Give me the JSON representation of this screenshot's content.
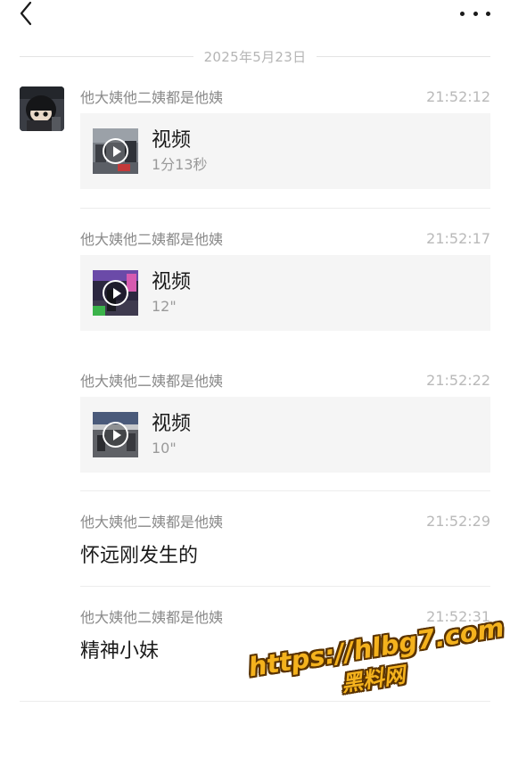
{
  "date_divider": "2025年5月23日",
  "icons": {
    "back": "chevron-left-icon",
    "more": "more-dots-icon",
    "play": "play-icon"
  },
  "messages": [
    {
      "sender": "他大姨他二姨都是他姨",
      "time": "21:52:12",
      "type": "video",
      "title": "视频",
      "duration": "1分13秒"
    },
    {
      "sender": "他大姨他二姨都是他姨",
      "time": "21:52:17",
      "type": "video",
      "title": "视频",
      "duration": "12\""
    },
    {
      "sender": "他大姨他二姨都是他姨",
      "time": "21:52:22",
      "type": "video",
      "title": "视频",
      "duration": "10\""
    },
    {
      "sender": "他大姨他二姨都是他姨",
      "time": "21:52:29",
      "type": "text",
      "text": "怀远刚发生的"
    },
    {
      "sender": "他大姨他二姨都是他姨",
      "time": "21:52:31",
      "type": "text",
      "text": "精神小妹"
    }
  ],
  "watermark": {
    "url": "https://hlbg7.com",
    "name": "黑料网"
  },
  "colors": {
    "card_bg": "#f5f5f5",
    "meta_text": "#8a8a8a",
    "time_text": "#b9b9b9",
    "watermark": "#f4b21d"
  }
}
